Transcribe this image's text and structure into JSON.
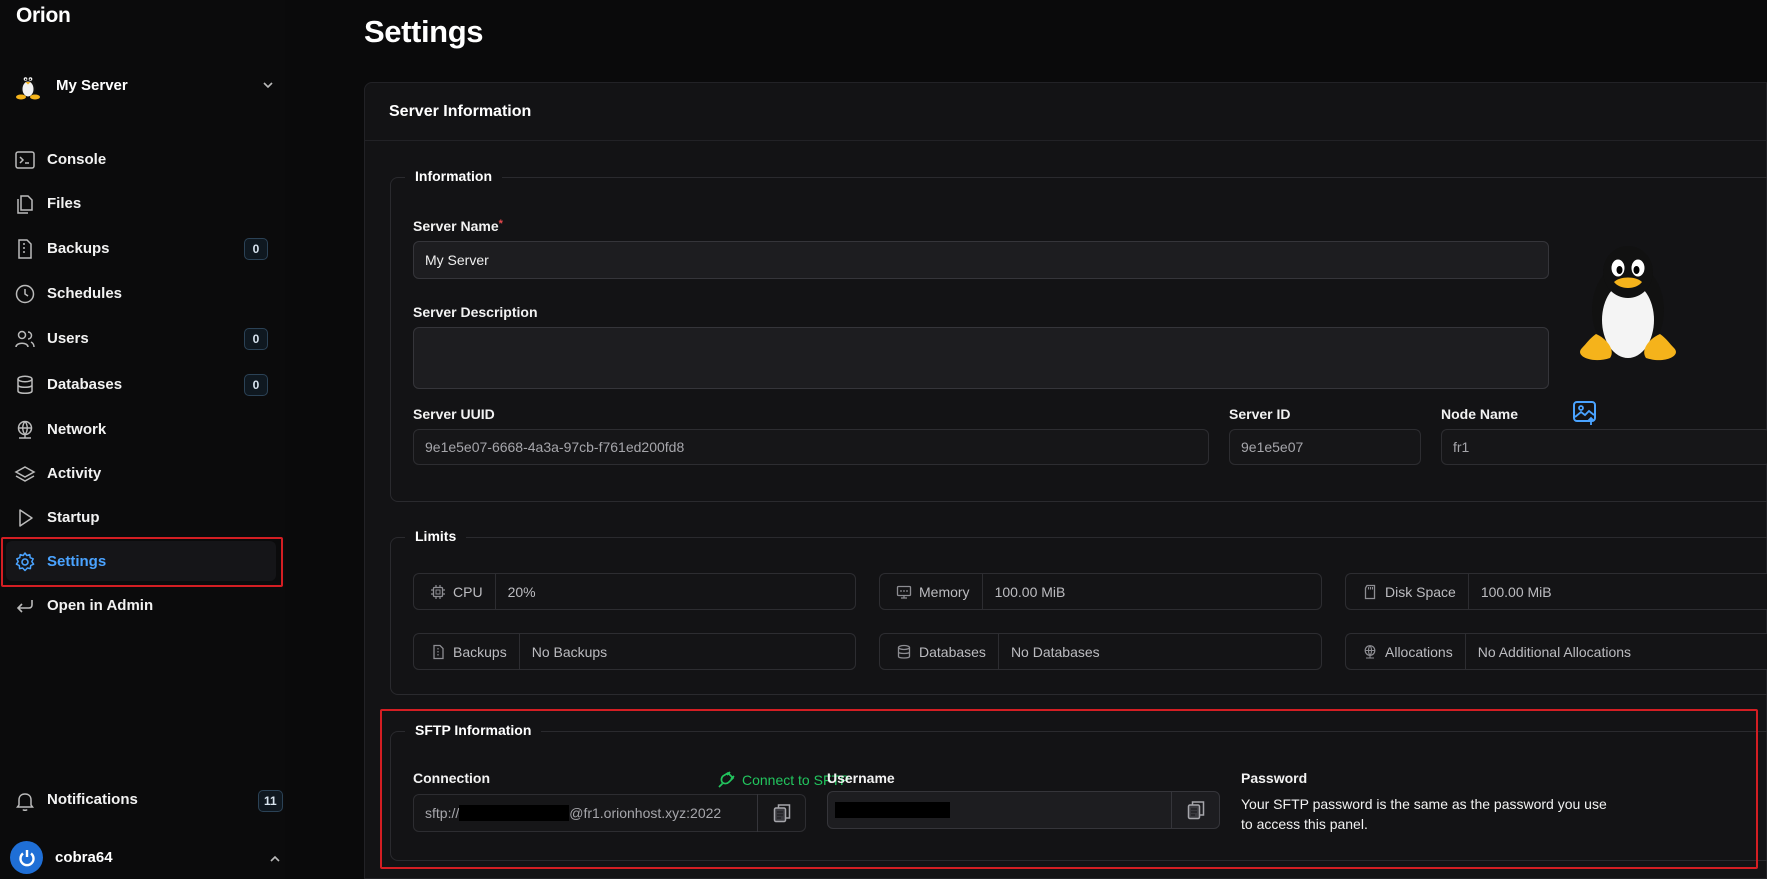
{
  "app": {
    "brand": "Orion"
  },
  "server_switch": {
    "name": "My Server"
  },
  "nav": {
    "items": [
      {
        "label": "Console",
        "icon": "terminal-icon"
      },
      {
        "label": "Files",
        "icon": "files-icon"
      },
      {
        "label": "Backups",
        "icon": "archive-icon",
        "count": "0"
      },
      {
        "label": "Schedules",
        "icon": "clock-icon"
      },
      {
        "label": "Users",
        "icon": "users-icon",
        "count": "0"
      },
      {
        "label": "Databases",
        "icon": "database-icon",
        "count": "0"
      },
      {
        "label": "Network",
        "icon": "network-icon"
      },
      {
        "label": "Activity",
        "icon": "layers-icon"
      },
      {
        "label": "Startup",
        "icon": "play-icon"
      },
      {
        "label": "Settings",
        "icon": "gear-icon",
        "active": true
      },
      {
        "label": "Open in Admin",
        "icon": "return-icon"
      }
    ],
    "notifications": {
      "label": "Notifications",
      "count": "11"
    },
    "user": {
      "name": "cobra64"
    }
  },
  "page": {
    "title": "Settings"
  },
  "card": {
    "title": "Server Information"
  },
  "information": {
    "legend": "Information",
    "server_name_label": "Server Name",
    "server_name_required": "*",
    "server_name_value": "My Server",
    "description_label": "Server Description",
    "description_value": "",
    "uuid_label": "Server UUID",
    "uuid_value": "9e1e5e07-6668-4a3a-97cb-f761ed200fd8",
    "server_id_label": "Server ID",
    "server_id_value": "9e1e5e07",
    "node_label": "Node Name",
    "node_value": "fr1"
  },
  "limits": {
    "legend": "Limits",
    "items": [
      {
        "name": "CPU",
        "value": "20%",
        "icon": "cpu-icon"
      },
      {
        "name": "Memory",
        "value": "100.00 MiB",
        "icon": "memory-icon"
      },
      {
        "name": "Disk Space",
        "value": "100.00 MiB",
        "icon": "sd-card-icon"
      },
      {
        "name": "Backups",
        "value": "No Backups",
        "icon": "archive-icon"
      },
      {
        "name": "Databases",
        "value": "No Databases",
        "icon": "database-icon"
      },
      {
        "name": "Allocations",
        "value": "No Additional Allocations",
        "icon": "network-icon"
      }
    ]
  },
  "sftp": {
    "legend": "SFTP Information",
    "connection_label": "Connection",
    "connect_link": "Connect to SFTP",
    "connection_prefix": "sftp://",
    "connection_suffix": "@fr1.orionhost.xyz:2022",
    "username_label": "Username",
    "password_label": "Password",
    "password_text": "Your SFTP password is the same as the password you use to access this panel."
  },
  "colors": {
    "accent": "#4aa3ff",
    "success": "#22c55e",
    "highlight": "#d41e23",
    "required": "#e5484d"
  }
}
